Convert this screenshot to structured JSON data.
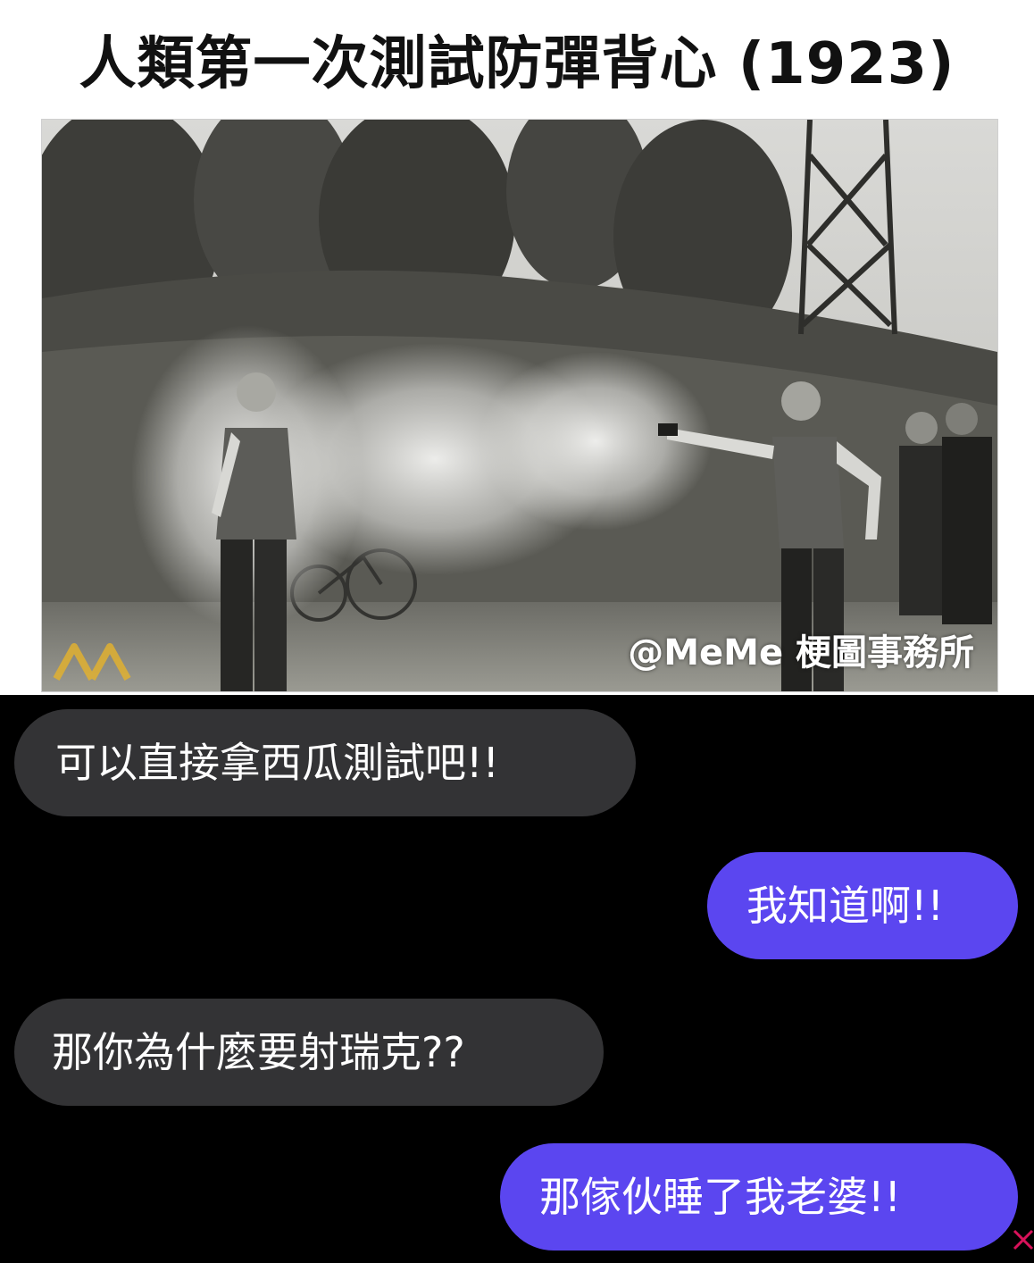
{
  "title": "人類第一次測試防彈背心 (1923)",
  "watermark": "@MeMe 梗圖事務所",
  "colors": {
    "incoming_bubble": "#333335",
    "outgoing_bubble": "#5b46f0",
    "background": "#000000"
  },
  "messages": [
    {
      "side": "incoming",
      "text": "可以直接拿西瓜測試吧!!"
    },
    {
      "side": "outgoing",
      "text": "我知道啊!!"
    },
    {
      "side": "incoming",
      "text": "那你為什麼要射瑞克??"
    },
    {
      "side": "outgoing",
      "text": "那傢伙睡了我老婆!!"
    }
  ]
}
